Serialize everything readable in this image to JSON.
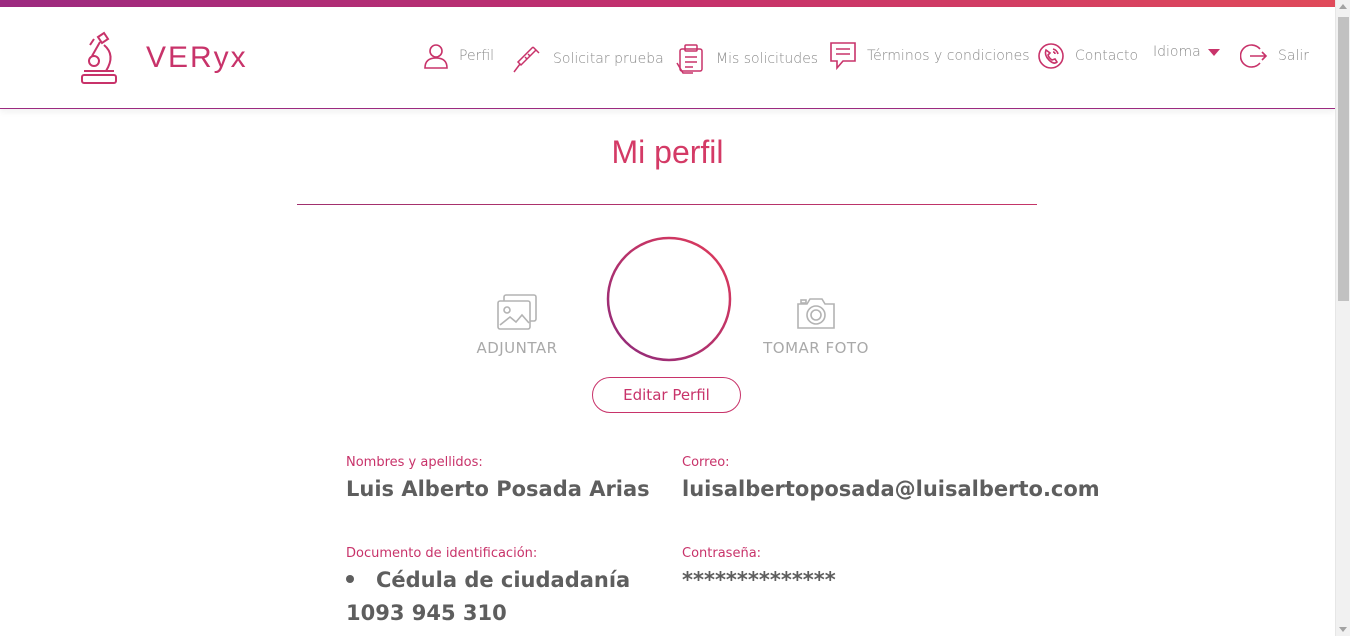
{
  "app": {
    "brand": "VERyx",
    "brand_gradient": [
      "#9c2a80",
      "#e04a5a"
    ],
    "accent": "#c8336a"
  },
  "nav": {
    "profile": {
      "label": "Perfil",
      "icon": "user-icon"
    },
    "request_test": {
      "label": "Solicitar prueba",
      "icon": "syringe-icon"
    },
    "my_requests": {
      "label": "Mis solicitudes",
      "icon": "clipboard-icon"
    },
    "terms": {
      "label": "Términos y condiciones",
      "icon": "message-lines-icon"
    },
    "contact": {
      "label": "Contacto",
      "icon": "phone-icon"
    },
    "language": {
      "label": "Idioma",
      "icon": "caret-down-icon"
    },
    "logout": {
      "label": "Salir",
      "icon": "logout-icon"
    }
  },
  "profile": {
    "title": "Mi perfil",
    "attach_label": "ADJUNTAR",
    "take_photo_label": "TOMAR FOTO",
    "edit_button": "Editar Perfil",
    "fields": {
      "name_label": "Nombres y apellidos:",
      "name_value": "Luis Alberto Posada Arias",
      "email_label": "Correo:",
      "email_value": "luisalbertoposada@luisalberto.com",
      "document_label": "Documento de identificación:",
      "document_type": "Cédula de ciudadanía",
      "document_number": "1093 945 310",
      "password_label": "Contraseña:",
      "password_value": "**************"
    }
  }
}
